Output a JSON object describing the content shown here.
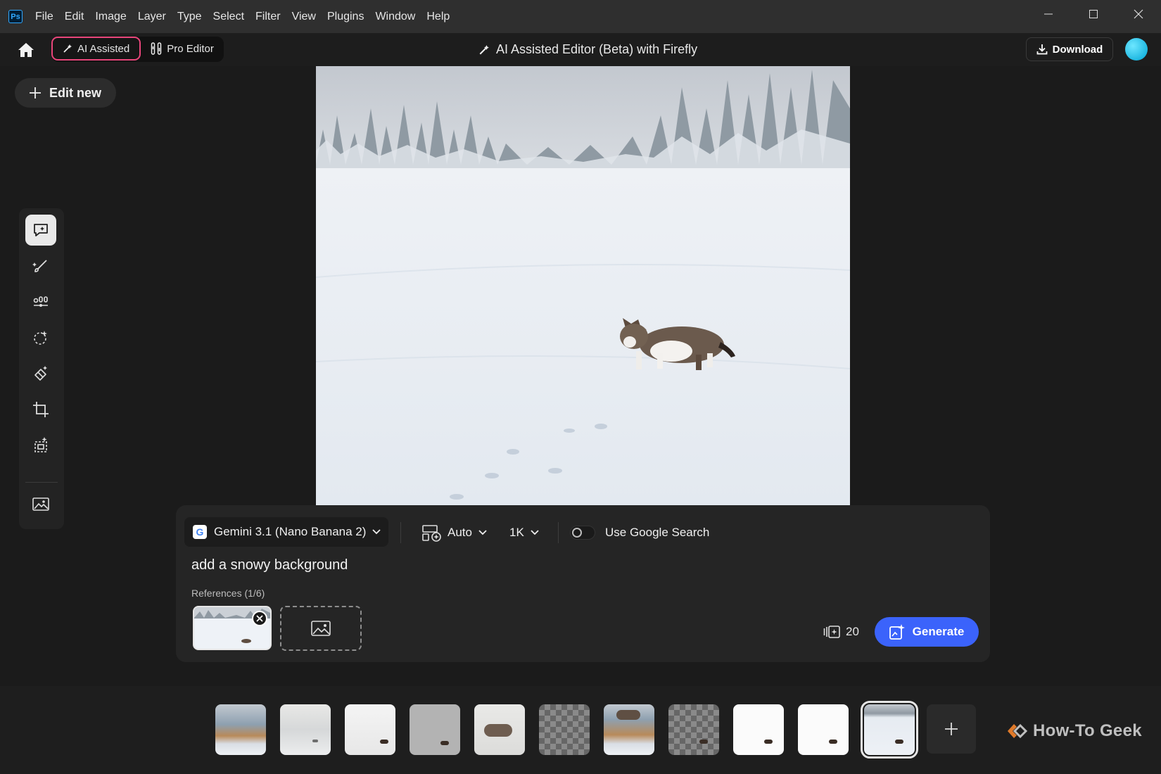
{
  "app": {
    "logo_text": "Ps",
    "menu": [
      "File",
      "Edit",
      "Image",
      "Layer",
      "Type",
      "Select",
      "Filter",
      "View",
      "Plugins",
      "Window",
      "Help"
    ]
  },
  "toolbar": {
    "mode_ai": "AI Assisted",
    "mode_pro": "Pro Editor",
    "title": "AI Assisted Editor (Beta) with Firefly",
    "download_label": "Download"
  },
  "left": {
    "edit_new_label": "Edit new",
    "tools": [
      "chat-edit-icon",
      "brush-icon",
      "adjustments-icon",
      "magic-select-icon",
      "eraser-icon",
      "crop-icon",
      "expand-icon",
      "image-icon"
    ]
  },
  "prompt": {
    "model": "Gemini 3.1 (Nano Banana 2)",
    "model_logo": "G",
    "aspect": "Auto",
    "resolution": "1K",
    "google_search_label": "Use Google Search",
    "google_search_on": false,
    "text": "add a snowy background",
    "references_label": "References (1/6)",
    "credits": "20",
    "generate_label": "Generate"
  },
  "filmstrip": {
    "thumbnails": [
      {
        "kind": "beach"
      },
      {
        "kind": "snow-light"
      },
      {
        "kind": "white-cat"
      },
      {
        "kind": "gray-cat"
      },
      {
        "kind": "cat-closeup"
      },
      {
        "kind": "transparent"
      },
      {
        "kind": "beach-cat"
      },
      {
        "kind": "transparent-cat"
      },
      {
        "kind": "white-cat"
      },
      {
        "kind": "white-cat"
      },
      {
        "kind": "snow-scene",
        "selected": true
      }
    ],
    "watermark": "How-To Geek"
  },
  "colors": {
    "accent_pink": "#e8457a",
    "generate_blue": "#3b63fb",
    "avatar": "#00a6d6"
  }
}
